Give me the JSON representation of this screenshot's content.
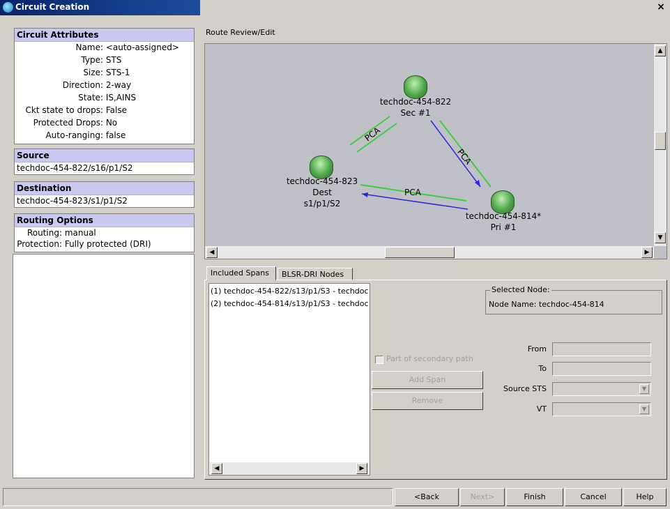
{
  "window": {
    "title": "Circuit Creation",
    "close_glyph": "×"
  },
  "attributes": {
    "title": "Circuit Attributes",
    "rows": [
      {
        "key": "Name:",
        "value": "<auto-assigned>"
      },
      {
        "key": "Type:",
        "value": "STS"
      },
      {
        "key": "Size:",
        "value": "STS-1"
      },
      {
        "key": "Direction:",
        "value": "2-way"
      },
      {
        "key": "State:",
        "value": "IS,AINS"
      },
      {
        "key": "Ckt state to drops:",
        "value": "False"
      },
      {
        "key": "Protected Drops:",
        "value": "No"
      },
      {
        "key": "Auto-ranging:",
        "value": "false"
      }
    ]
  },
  "source": {
    "title": "Source",
    "value": "techdoc-454-822/s16/p1/S2"
  },
  "destination": {
    "title": "Destination",
    "value": "techdoc-454-823/s1/p1/S2"
  },
  "routing": {
    "title": "Routing Options",
    "rows": [
      {
        "key": "Routing:",
        "value": "manual"
      },
      {
        "key": "Protection:",
        "value": "Fully protected (DRI)"
      }
    ]
  },
  "route_review": {
    "label": "Route Review/Edit",
    "nodes": [
      {
        "name": "techdoc-454-822",
        "sub": "Sec #1",
        "sub2": ""
      },
      {
        "name": "techdoc-454-823",
        "sub": "Dest",
        "sub2": "s1/p1/S2"
      },
      {
        "name": "techdoc-454-814*",
        "sub": "Pri #1",
        "sub2": ""
      }
    ],
    "link_label": "PCA"
  },
  "tabs": [
    {
      "label": "Included Spans",
      "active": true
    },
    {
      "label": "BLSR-DRI Nodes",
      "active": false
    }
  ],
  "spans": [
    "(1) techdoc-454-822/s13/p1/S3 - techdoc",
    "(2) techdoc-454-814/s13/p1/S3 - techdoc"
  ],
  "selected_node": {
    "title": "Selected Node:",
    "node_name_label": "Node Name:",
    "node_name": "techdoc-454-814"
  },
  "span_controls": {
    "secondary_checkbox": "Part of secondary path",
    "add_span": "Add Span",
    "remove": "Remove",
    "from_label": "From",
    "to_label": "To",
    "source_sts_label": "Source STS",
    "vt_label": "VT"
  },
  "footer": {
    "back": "<Back",
    "next": "Next>",
    "finish": "Finish",
    "cancel": "Cancel",
    "help": "Help"
  },
  "colors": {
    "link_green": "#3ad03a",
    "link_blue": "#2a2ad8",
    "panel_head": "#c8c8f0",
    "canvas": "#c0c0c8"
  }
}
